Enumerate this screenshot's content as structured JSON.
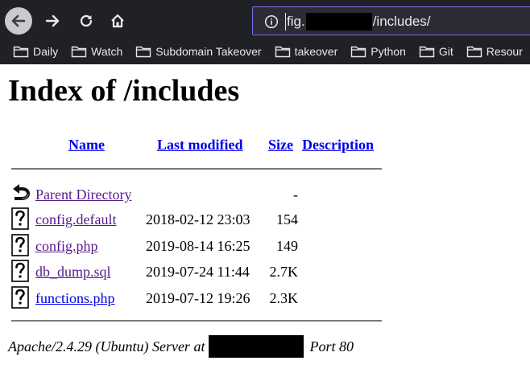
{
  "browser": {
    "url_prefix": "fig.",
    "url_suffix": "/includes/",
    "bookmarks": [
      {
        "label": "Daily"
      },
      {
        "label": "Watch"
      },
      {
        "label": "Subdomain Takeover"
      },
      {
        "label": "takeover"
      },
      {
        "label": "Python"
      },
      {
        "label": "Git"
      },
      {
        "label": "Resour"
      }
    ]
  },
  "page": {
    "title": "Index of /includes",
    "columns": {
      "name": "Name",
      "last_modified": "Last modified",
      "size": "Size",
      "description": "Description"
    },
    "parent": {
      "name": "Parent Directory",
      "size": "-"
    },
    "files": [
      {
        "name": "config.default",
        "date": "2018-02-12 23:03",
        "size": "154"
      },
      {
        "name": "config.php",
        "date": "2019-08-14 16:25",
        "size": "149"
      },
      {
        "name": "db_dump.sql",
        "date": "2019-07-24 11:44",
        "size": "2.7K"
      },
      {
        "name": "functions.php",
        "date": "2019-07-12 19:26",
        "size": "2.3K"
      }
    ],
    "footer": {
      "prefix": "Apache/2.4.29 (Ubuntu) Server at",
      "suffix": "Port 80"
    }
  },
  "colors": {
    "chrome_bg": "#202124",
    "link": "#0000ee",
    "visited_link": "#551a8b",
    "url_bar_border": "#7a6df0"
  },
  "icons": [
    "back-icon",
    "forward-icon",
    "reload-icon",
    "home-icon",
    "info-icon",
    "folder-icon",
    "parent-directory-icon",
    "unknown-file-icon"
  ]
}
